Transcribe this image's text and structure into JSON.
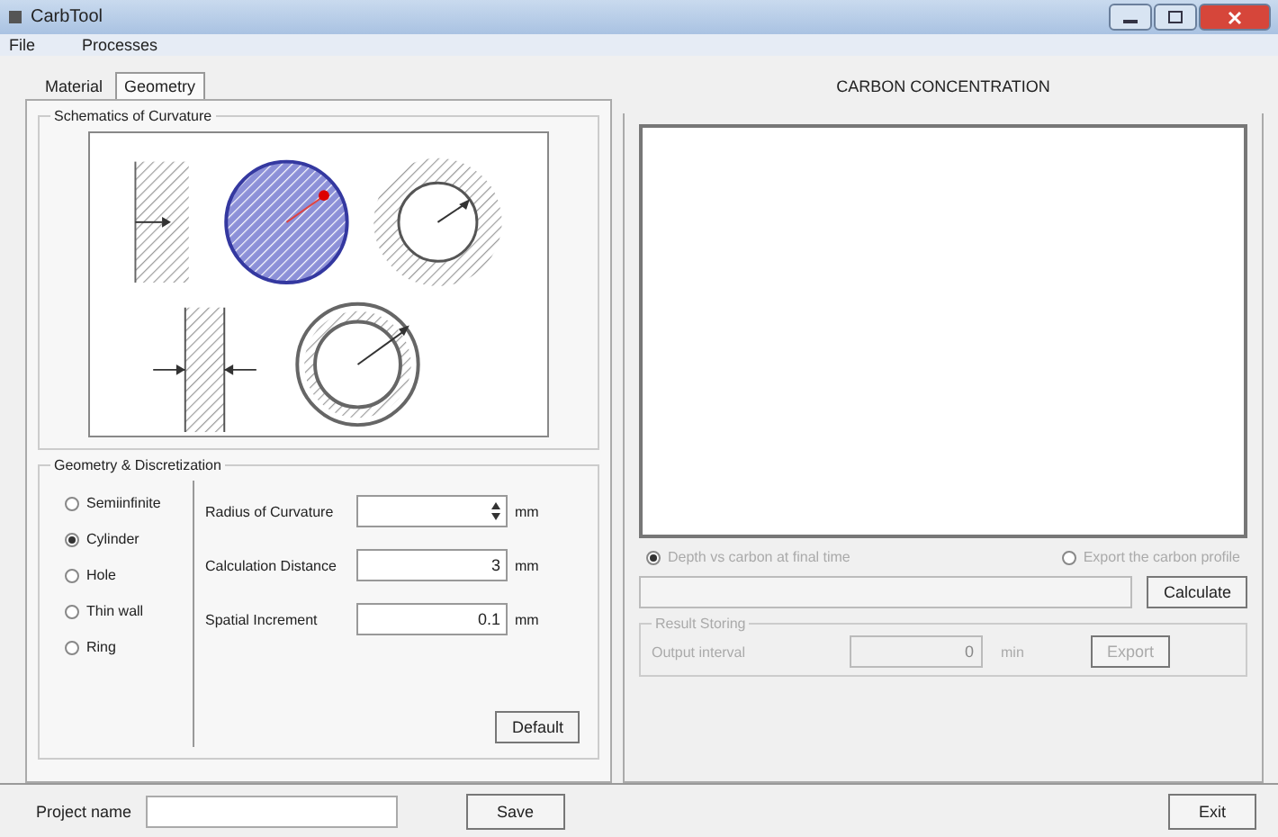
{
  "window": {
    "title": "CarbTool"
  },
  "menu": [
    "File",
    "Processes"
  ],
  "tabs": [
    {
      "label": "Material",
      "selected": false
    },
    {
      "label": "Geometry",
      "selected": true
    }
  ],
  "schematic": {
    "title": "Schematics of Curvature"
  },
  "geometry": {
    "title": "Geometry & Discretization",
    "shapes": [
      {
        "label": "Semiinfinite",
        "selected": false
      },
      {
        "label": "Cylinder",
        "selected": true
      },
      {
        "label": "Hole",
        "selected": false
      },
      {
        "label": "Thin wall",
        "selected": false
      },
      {
        "label": "Ring",
        "selected": false
      }
    ],
    "fields": [
      {
        "label": "Radius of Curvature",
        "spinner": true,
        "unit": "mm"
      },
      {
        "label": "Calculation Distance",
        "value": "3",
        "spinner": false,
        "unit": "mm"
      },
      {
        "label": "Spatial Increment",
        "value": "0.1",
        "spinner": false,
        "unit": "mm"
      }
    ],
    "default_button": "Default"
  },
  "project": {
    "label": "Project name",
    "save": "Save",
    "exit": "Exit"
  },
  "result": {
    "title": "CARBON CONCENTRATION",
    "options": [
      {
        "label": "Depth vs carbon at final time",
        "selected": true,
        "disabled": true
      },
      {
        "label": "Export the carbon profile",
        "selected": false,
        "disabled": true
      }
    ],
    "calculate": "Calculate",
    "storing": {
      "title": "Result Storing",
      "label": "Output interval",
      "value": "0",
      "unit": "min",
      "export": "Export",
      "disabled": true
    }
  }
}
